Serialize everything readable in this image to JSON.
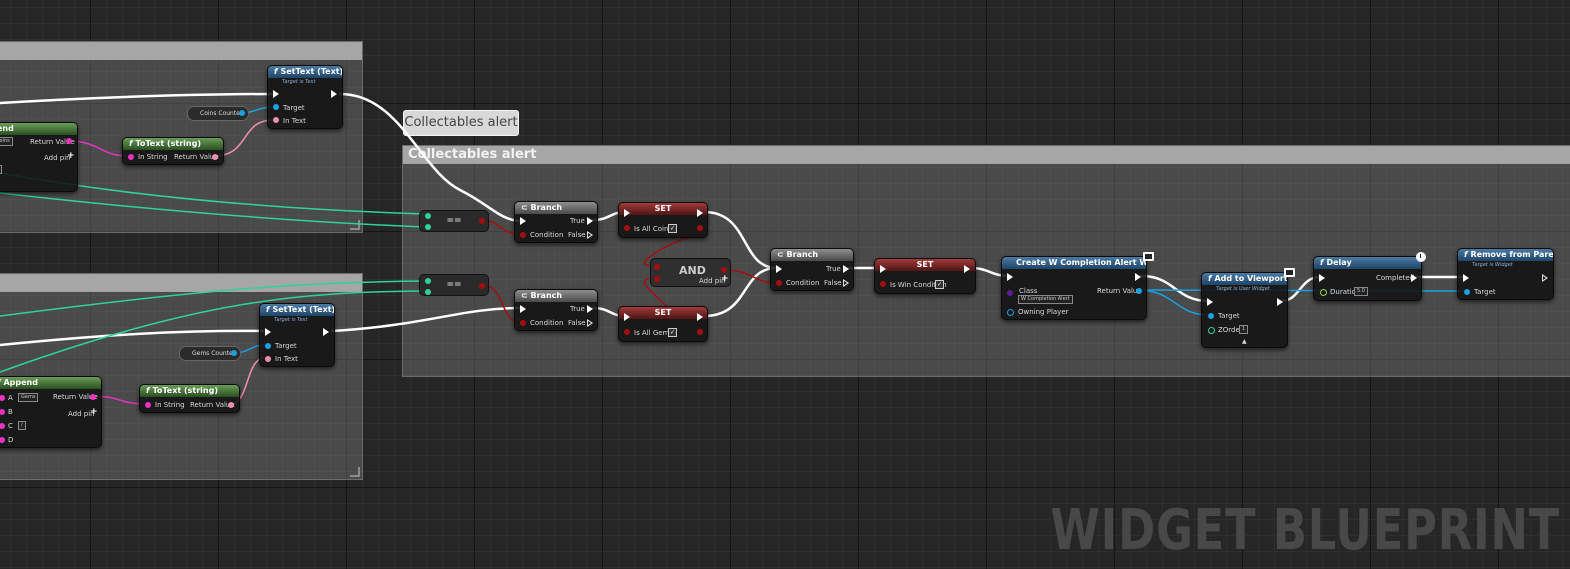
{
  "comments": {
    "top": "",
    "bottom": "",
    "right": "Collectables alert",
    "bubble": "Collectables alert"
  },
  "nodes": {
    "settext_top": {
      "title": "SetText (Text)",
      "subtitle": "Target is Text",
      "target": "Target",
      "in_text": "In Text"
    },
    "coins_counter": "Coins Counter",
    "append_top": {
      "title": "end",
      "a_value": "Coins",
      "return_value": "Return Value",
      "add_pin": "Add pin"
    },
    "totext_top": {
      "title": "ToText (string)",
      "in_string": "In String",
      "return_value": "Return Value"
    },
    "settext_bottom": {
      "title": "SetText (Text)",
      "subtitle": "Target is Text",
      "target": "Target",
      "in_text": "In Text"
    },
    "gems_counter": "Gems Counter",
    "append_bottom": {
      "title": "Append",
      "a": "A",
      "a_value": "Gems",
      "b": "B",
      "c": "C",
      "c_value": "/",
      "d": "D",
      "return_value": "Return Value",
      "add_pin": "Add pin"
    },
    "totext_bottom": {
      "title": "ToText (string)",
      "in_string": "In String",
      "return_value": "Return Value"
    },
    "equal_top": "==",
    "equal_bottom": "==",
    "branch_top": {
      "title": "Branch",
      "condition": "Condition",
      "true": "True",
      "false": "False"
    },
    "branch_bottom": {
      "title": "Branch",
      "condition": "Condition",
      "true": "True",
      "false": "False"
    },
    "set_coins": {
      "title": "SET",
      "var": "Is All Coins"
    },
    "set_gems": {
      "title": "SET",
      "var": "Is All Gems"
    },
    "and_node": {
      "title": "AND",
      "add_pin": "Add pin"
    },
    "branch_mid": {
      "title": "Branch",
      "condition": "Condition",
      "true": "True",
      "false": "False"
    },
    "set_win": {
      "title": "SET",
      "var": "Is Win Condition"
    },
    "create_widget": {
      "title": "Create W Completion Alert Widget",
      "class": "Class",
      "class_value": "W Completion Alert",
      "return_value": "Return Value",
      "owning_player": "Owning Player"
    },
    "add_viewport": {
      "title": "Add to Viewport",
      "subtitle": "Target is User Widget",
      "target": "Target",
      "zorder": "ZOrder",
      "zorder_value": "1"
    },
    "delay": {
      "title": "Delay",
      "completed": "Completed",
      "duration": "Duration",
      "duration_value": "5.0"
    },
    "remove_parent": {
      "title": "Remove from Parent",
      "subtitle": "Target is Widget",
      "target": "Target"
    }
  },
  "watermark": "WIDGET BLUEPRINT",
  "colors": {
    "exec": "#ffffff",
    "bool": "#a30f0f",
    "object": "#1ba1e2",
    "string": "#ea33c0",
    "text": "#f18fae",
    "int": "#2fd39a",
    "float": "#9ad23b"
  }
}
